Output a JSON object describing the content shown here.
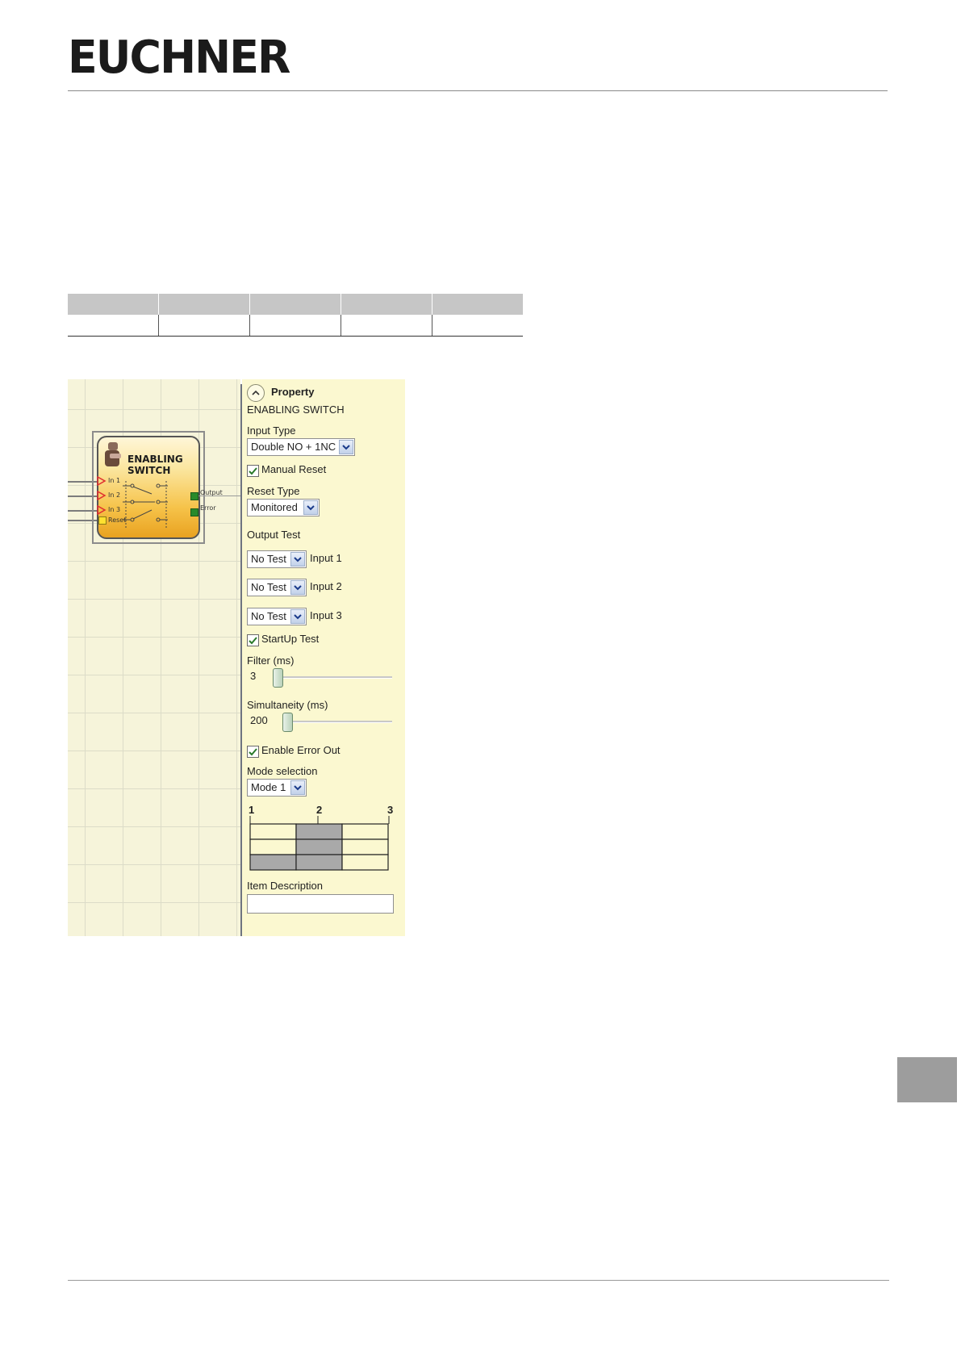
{
  "header": {
    "logo_text": "EUCHNER"
  },
  "table": {
    "columns": 5
  },
  "screenshot": {
    "function_block": {
      "title_line1": "ENABLING",
      "title_line2": "SWITCH",
      "inputs": [
        "In 1",
        "In 2",
        "In 3",
        "Reset"
      ],
      "outputs": [
        "Output",
        "Error"
      ]
    },
    "property_panel": {
      "header": "Property",
      "element_name": "ENABLING SWITCH",
      "input_type_label": "Input Type",
      "input_type_value": "Double NO + 1NC",
      "manual_reset_label": "Manual Reset",
      "manual_reset_checked": true,
      "reset_type_label": "Reset Type",
      "reset_type_value": "Monitored",
      "output_test_label": "Output Test",
      "output_tests": [
        {
          "value": "No Test",
          "input": "Input 1"
        },
        {
          "value": "No Test",
          "input": "Input 2"
        },
        {
          "value": "No Test",
          "input": "Input 3"
        }
      ],
      "startup_test_label": "StartUp Test",
      "startup_test_checked": true,
      "filter_label": "Filter (ms)",
      "filter_value": "3",
      "simultaneity_label": "Simultaneity (ms)",
      "simultaneity_value": "200",
      "enable_error_out_label": "Enable Error Out",
      "enable_error_out_checked": true,
      "mode_selection_label": "Mode selection",
      "mode_selection_value": "Mode 1",
      "mode_diagram": {
        "positions": [
          "1",
          "2",
          "3"
        ],
        "shaded": [
          [
            false,
            true,
            false
          ],
          [
            false,
            true,
            false
          ],
          [
            true,
            true,
            false
          ]
        ]
      },
      "item_description_label": "Item Description",
      "item_description_value": ""
    }
  },
  "colors": {
    "panel_bg": "#fbf8d0",
    "block_orange": "#f6c34a",
    "output_green": "#2a8a2a",
    "side_tab": "#9d9d9d"
  }
}
